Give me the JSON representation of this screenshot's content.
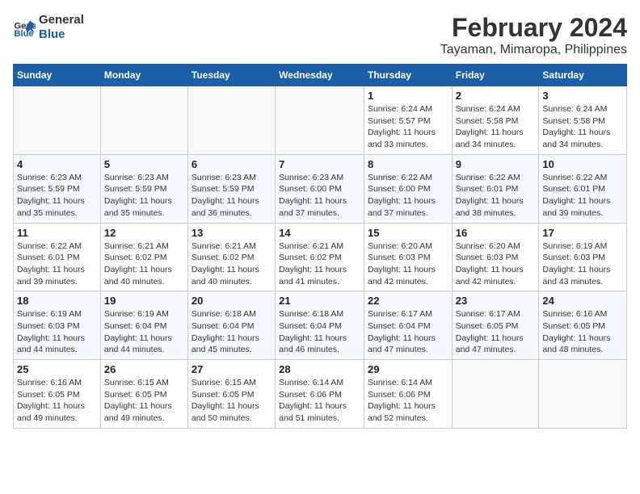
{
  "header": {
    "logo_line1": "General",
    "logo_line2": "Blue",
    "title": "February 2024",
    "subtitle": "Tayaman, Mimaropa, Philippines"
  },
  "days_of_week": [
    "Sunday",
    "Monday",
    "Tuesday",
    "Wednesday",
    "Thursday",
    "Friday",
    "Saturday"
  ],
  "weeks": [
    [
      {
        "day": "",
        "info": ""
      },
      {
        "day": "",
        "info": ""
      },
      {
        "day": "",
        "info": ""
      },
      {
        "day": "",
        "info": ""
      },
      {
        "day": "1",
        "info": "Sunrise: 6:24 AM\nSunset: 5:57 PM\nDaylight: 11 hours\nand 33 minutes."
      },
      {
        "day": "2",
        "info": "Sunrise: 6:24 AM\nSunset: 5:58 PM\nDaylight: 11 hours\nand 34 minutes."
      },
      {
        "day": "3",
        "info": "Sunrise: 6:24 AM\nSunset: 5:58 PM\nDaylight: 11 hours\nand 34 minutes."
      }
    ],
    [
      {
        "day": "4",
        "info": "Sunrise: 6:23 AM\nSunset: 5:59 PM\nDaylight: 11 hours\nand 35 minutes."
      },
      {
        "day": "5",
        "info": "Sunrise: 6:23 AM\nSunset: 5:59 PM\nDaylight: 11 hours\nand 35 minutes."
      },
      {
        "day": "6",
        "info": "Sunrise: 6:23 AM\nSunset: 5:59 PM\nDaylight: 11 hours\nand 36 minutes."
      },
      {
        "day": "7",
        "info": "Sunrise: 6:23 AM\nSunset: 6:00 PM\nDaylight: 11 hours\nand 37 minutes."
      },
      {
        "day": "8",
        "info": "Sunrise: 6:22 AM\nSunset: 6:00 PM\nDaylight: 11 hours\nand 37 minutes."
      },
      {
        "day": "9",
        "info": "Sunrise: 6:22 AM\nSunset: 6:01 PM\nDaylight: 11 hours\nand 38 minutes."
      },
      {
        "day": "10",
        "info": "Sunrise: 6:22 AM\nSunset: 6:01 PM\nDaylight: 11 hours\nand 39 minutes."
      }
    ],
    [
      {
        "day": "11",
        "info": "Sunrise: 6:22 AM\nSunset: 6:01 PM\nDaylight: 11 hours\nand 39 minutes."
      },
      {
        "day": "12",
        "info": "Sunrise: 6:21 AM\nSunset: 6:02 PM\nDaylight: 11 hours\nand 40 minutes."
      },
      {
        "day": "13",
        "info": "Sunrise: 6:21 AM\nSunset: 6:02 PM\nDaylight: 11 hours\nand 40 minutes."
      },
      {
        "day": "14",
        "info": "Sunrise: 6:21 AM\nSunset: 6:02 PM\nDaylight: 11 hours\nand 41 minutes."
      },
      {
        "day": "15",
        "info": "Sunrise: 6:20 AM\nSunset: 6:03 PM\nDaylight: 11 hours\nand 42 minutes."
      },
      {
        "day": "16",
        "info": "Sunrise: 6:20 AM\nSunset: 6:03 PM\nDaylight: 11 hours\nand 42 minutes."
      },
      {
        "day": "17",
        "info": "Sunrise: 6:19 AM\nSunset: 6:03 PM\nDaylight: 11 hours\nand 43 minutes."
      }
    ],
    [
      {
        "day": "18",
        "info": "Sunrise: 6:19 AM\nSunset: 6:03 PM\nDaylight: 11 hours\nand 44 minutes."
      },
      {
        "day": "19",
        "info": "Sunrise: 6:19 AM\nSunset: 6:04 PM\nDaylight: 11 hours\nand 44 minutes."
      },
      {
        "day": "20",
        "info": "Sunrise: 6:18 AM\nSunset: 6:04 PM\nDaylight: 11 hours\nand 45 minutes."
      },
      {
        "day": "21",
        "info": "Sunrise: 6:18 AM\nSunset: 6:04 PM\nDaylight: 11 hours\nand 46 minutes."
      },
      {
        "day": "22",
        "info": "Sunrise: 6:17 AM\nSunset: 6:04 PM\nDaylight: 11 hours\nand 47 minutes."
      },
      {
        "day": "23",
        "info": "Sunrise: 6:17 AM\nSunset: 6:05 PM\nDaylight: 11 hours\nand 47 minutes."
      },
      {
        "day": "24",
        "info": "Sunrise: 6:16 AM\nSunset: 6:05 PM\nDaylight: 11 hours\nand 48 minutes."
      }
    ],
    [
      {
        "day": "25",
        "info": "Sunrise: 6:16 AM\nSunset: 6:05 PM\nDaylight: 11 hours\nand 49 minutes."
      },
      {
        "day": "26",
        "info": "Sunrise: 6:15 AM\nSunset: 6:05 PM\nDaylight: 11 hours\nand 49 minutes."
      },
      {
        "day": "27",
        "info": "Sunrise: 6:15 AM\nSunset: 6:05 PM\nDaylight: 11 hours\nand 50 minutes."
      },
      {
        "day": "28",
        "info": "Sunrise: 6:14 AM\nSunset: 6:06 PM\nDaylight: 11 hours\nand 51 minutes."
      },
      {
        "day": "29",
        "info": "Sunrise: 6:14 AM\nSunset: 6:06 PM\nDaylight: 11 hours\nand 52 minutes."
      },
      {
        "day": "",
        "info": ""
      },
      {
        "day": "",
        "info": ""
      }
    ]
  ]
}
